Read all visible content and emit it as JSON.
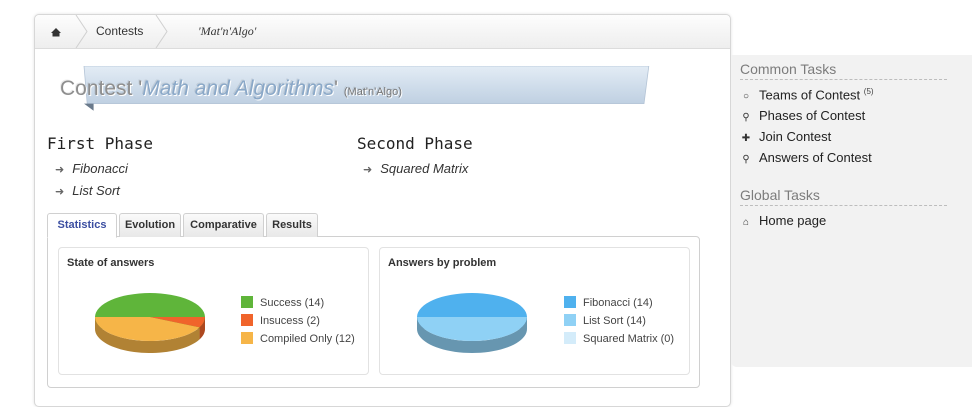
{
  "breadcrumb": {
    "contests": "Contests",
    "current": "'Mat'n'Algo'"
  },
  "banner": {
    "prefix": "Contest '",
    "name": "Math and Algorithms",
    "suffix": "'",
    "short": "(Mat'n'Algo)"
  },
  "phases": [
    {
      "title": "First Phase",
      "problems": [
        "Fibonacci",
        "List Sort"
      ]
    },
    {
      "title": "Second Phase",
      "problems": [
        "Squared Matrix"
      ]
    }
  ],
  "tabs": [
    "Statistics",
    "Evolution",
    "Comparative",
    "Results"
  ],
  "cards": {
    "state": {
      "title": "State of answers",
      "legend": [
        {
          "label": "Success (14)",
          "color": "#5fb53a"
        },
        {
          "label": "Insucess (2)",
          "color": "#f0642b"
        },
        {
          "label": "Compiled Only (12)",
          "color": "#f6b548"
        }
      ]
    },
    "byproblem": {
      "title": "Answers by problem",
      "legend": [
        {
          "label": "Fibonacci (14)",
          "color": "#4fb1ee"
        },
        {
          "label": "List Sort (14)",
          "color": "#8fd1f5"
        },
        {
          "label": "Squared Matrix (0)",
          "color": "#d4ecfa"
        }
      ]
    }
  },
  "chart_data": [
    {
      "type": "pie",
      "title": "State of answers",
      "categories": [
        "Success",
        "Insucess",
        "Compiled Only"
      ],
      "values": [
        14,
        2,
        12
      ]
    },
    {
      "type": "pie",
      "title": "Answers by problem",
      "categories": [
        "Fibonacci",
        "List Sort",
        "Squared Matrix"
      ],
      "values": [
        14,
        14,
        0
      ]
    }
  ],
  "sidebar": {
    "common_heading": "Common Tasks",
    "common_links": [
      {
        "label": "Teams of Contest",
        "badge": "(5)",
        "icon": "circle-icon"
      },
      {
        "label": "Phases of Contest",
        "icon": "magnifier-icon"
      },
      {
        "label": "Join Contest",
        "icon": "plus-icon"
      },
      {
        "label": "Answers of Contest",
        "icon": "magnifier-icon"
      }
    ],
    "global_heading": "Global Tasks",
    "global_links": [
      {
        "label": "Home page",
        "icon": "home-icon"
      }
    ]
  }
}
